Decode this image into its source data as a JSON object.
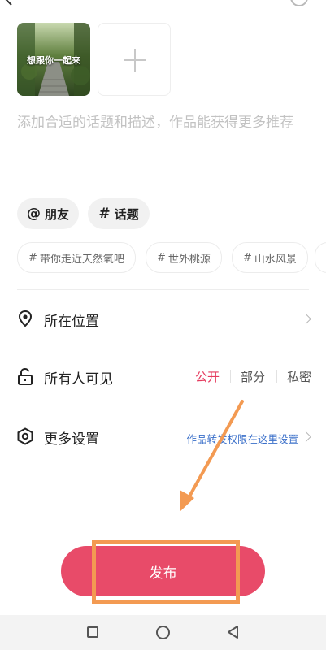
{
  "media": {
    "thumbnail_caption": "想跟你一起来"
  },
  "description": {
    "placeholder": "添加合适的话题和描述，作品能获得更多推荐"
  },
  "chips": {
    "friends_symbol": "@",
    "friends_label": "朋友",
    "topic_symbol": "#",
    "topic_label": "话题"
  },
  "suggested_topics": [
    {
      "hash": "#",
      "label": "带你走近天然氧吧"
    },
    {
      "hash": "#",
      "label": "世外桃源"
    },
    {
      "hash": "#",
      "label": "山水风景"
    }
  ],
  "settings": {
    "location_label": "所在位置",
    "visibility_label": "所有人可见",
    "visibility_options": [
      "公开",
      "部分",
      "私密"
    ],
    "visibility_selected": "公开",
    "more_label": "更多设置",
    "more_hint": "作品转发权限在这里设置"
  },
  "publish": {
    "label": "发布"
  },
  "colors": {
    "accent": "#e84b69",
    "selected_text": "#e53c5f",
    "link": "#3a6fc9",
    "annotation": "#f39a52"
  }
}
